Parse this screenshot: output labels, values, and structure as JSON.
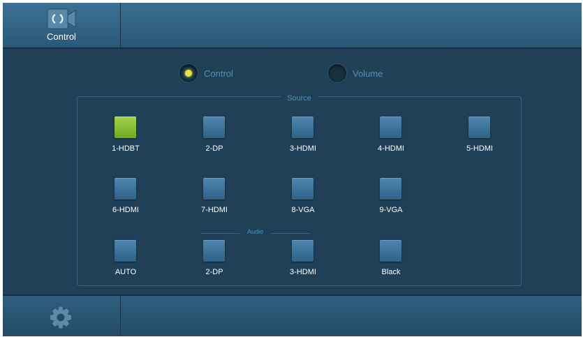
{
  "header": {
    "tab_label": "Control",
    "tab_icon": "control-icon"
  },
  "mode_selector": {
    "options": [
      {
        "label": "Control",
        "selected": true
      },
      {
        "label": "Volume",
        "selected": false
      }
    ],
    "accent_color": "#e4e23c"
  },
  "source_group": {
    "title": "Source",
    "video_buttons": [
      {
        "label": "1-HDBT",
        "active": true
      },
      {
        "label": "2-DP",
        "active": false
      },
      {
        "label": "3-HDMI",
        "active": false
      },
      {
        "label": "4-HDMI",
        "active": false
      },
      {
        "label": "5-HDMI",
        "active": false
      },
      {
        "label": "6-HDMI",
        "active": false
      },
      {
        "label": "7-HDMI",
        "active": false
      },
      {
        "label": "8-VGA",
        "active": false
      },
      {
        "label": "9-VGA",
        "active": false
      }
    ],
    "audio_title": "Audio",
    "audio_buttons": [
      {
        "label": "AUTO",
        "active": false
      },
      {
        "label": "2-DP",
        "active": false
      },
      {
        "label": "3-HDMI",
        "active": false
      },
      {
        "label": "Black",
        "active": false
      }
    ],
    "active_color": "#8fc636"
  },
  "footer": {
    "settings_icon": "gear-icon"
  }
}
